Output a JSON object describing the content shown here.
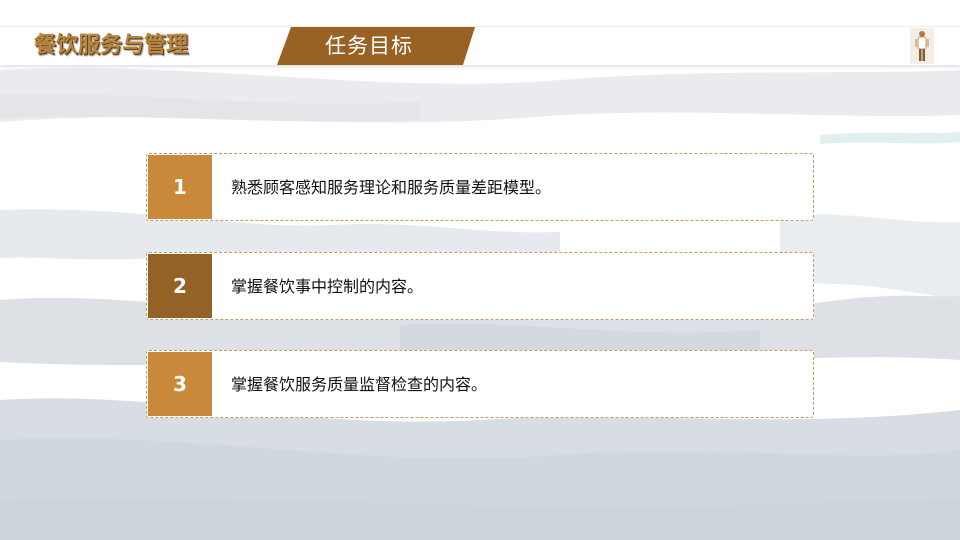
{
  "header": {
    "course_title": "餐饮服务与管理",
    "section_title": "任务目标"
  },
  "icons": {
    "header_figure": "chef-figure-icon"
  },
  "objectives": [
    {
      "number": "1",
      "text": "熟悉顾客感知服务理论和服务质量差距模型。",
      "color": "#c8893a"
    },
    {
      "number": "2",
      "text": "掌握餐饮事中控制的内容。",
      "color": "#946127"
    },
    {
      "number": "3",
      "text": "掌握餐饮服务质量监督检查的内容。",
      "color": "#c8893a"
    }
  ],
  "colors": {
    "accent": "#986225",
    "title": "#b8863f",
    "card_border": "#c49a6a"
  }
}
